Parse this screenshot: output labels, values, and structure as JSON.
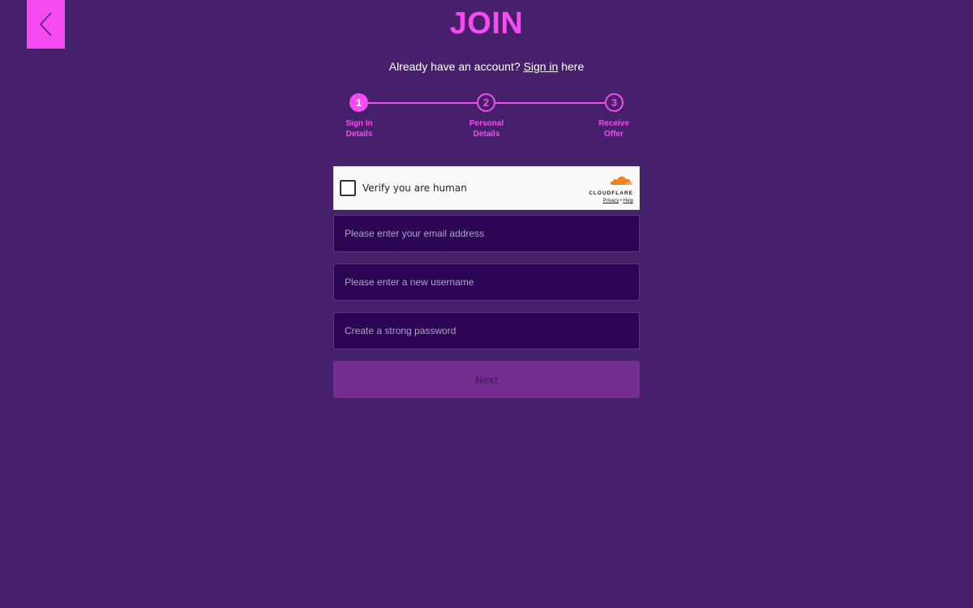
{
  "header": {
    "title": "JOIN",
    "back_icon": "chevron-left-icon"
  },
  "signin": {
    "prefix": "Already have an account?",
    "link": "Sign in",
    "suffix": "here"
  },
  "stepper": {
    "current_step": 1,
    "steps": [
      {
        "number": "1",
        "label_line1": "Sign In",
        "label_line2": "Details"
      },
      {
        "number": "2",
        "label_line1": "Personal",
        "label_line2": "Details"
      },
      {
        "number": "3",
        "label_line1": "Receive",
        "label_line2": "Offer"
      }
    ]
  },
  "captcha": {
    "label": "Verify you are human",
    "brand": "CLOUDFLARE",
    "privacy_link": "Privacy",
    "separator": "•",
    "help_link": "Help"
  },
  "form": {
    "email_placeholder": "Please enter your email address",
    "email_value": "",
    "username_placeholder": "Please enter a new username",
    "username_value": "",
    "password_placeholder": "Create a strong password",
    "password_value": "",
    "next_label": "Next"
  },
  "colors": {
    "background": "#46206b",
    "accent": "#f54bf0",
    "field_background": "#2c0554",
    "button_disabled": "#732d91"
  }
}
